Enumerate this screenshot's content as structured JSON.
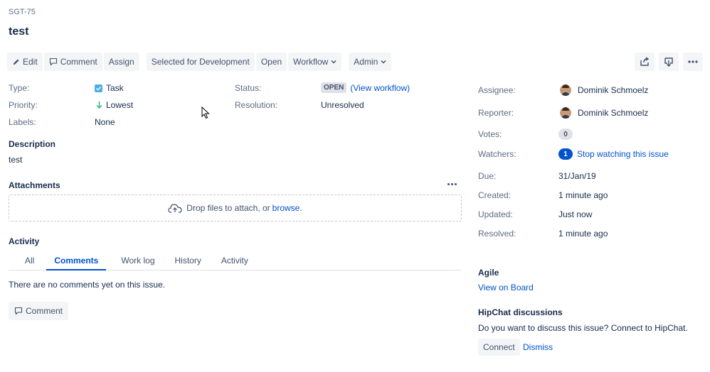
{
  "issue": {
    "key": "SGT-75",
    "title": "test"
  },
  "toolbar": {
    "edit": "Edit",
    "comment": "Comment",
    "assign": "Assign",
    "selected_for_dev": "Selected for Development",
    "open": "Open",
    "workflow": "Workflow",
    "admin": "Admin"
  },
  "details": {
    "type_label": "Type:",
    "type_value": "Task",
    "priority_label": "Priority:",
    "priority_value": "Lowest",
    "labels_label": "Labels:",
    "labels_value": "None",
    "status_label": "Status:",
    "status_value": "OPEN",
    "view_workflow": "(View workflow)",
    "resolution_label": "Resolution:",
    "resolution_value": "Unresolved"
  },
  "description": {
    "title": "Description",
    "text": "test"
  },
  "attachments": {
    "title": "Attachments",
    "drop_text": "Drop files to attach, or",
    "browse": "browse."
  },
  "activity": {
    "title": "Activity",
    "tabs": [
      "All",
      "Comments",
      "Work log",
      "History",
      "Activity"
    ],
    "active_tab": "Comments",
    "empty_text": "There are no comments yet on this issue.",
    "comment_button": "Comment"
  },
  "people": {
    "assignee_label": "Assignee:",
    "assignee": "Dominik Schmoelz",
    "reporter_label": "Reporter:",
    "reporter": "Dominik Schmoelz",
    "votes_label": "Votes:",
    "votes": "0",
    "watchers_label": "Watchers:",
    "watchers": "1",
    "stop_watching": "Stop watching this issue"
  },
  "dates": {
    "due_label": "Due:",
    "due": "31/Jan/19",
    "created_label": "Created:",
    "created": "1 minute ago",
    "updated_label": "Updated:",
    "updated": "Just now",
    "resolved_label": "Resolved:",
    "resolved": "1 minute ago"
  },
  "agile": {
    "title": "Agile",
    "link": "View on Board"
  },
  "hipchat": {
    "title": "HipChat discussions",
    "text": "Do you want to discuss this issue? Connect to HipChat.",
    "connect": "Connect",
    "dismiss": "Dismiss"
  },
  "colors": {
    "link": "#0052cc",
    "text": "#172b4d",
    "muted": "#5e6c84",
    "button_bg": "#f4f5f7",
    "priority_lowest": "#36b37e",
    "task_blue": "#4bade8"
  },
  "icons": [
    "pencil-icon",
    "comment-icon",
    "chevron-down-icon",
    "share-icon",
    "export-icon",
    "more-icon",
    "task-icon",
    "arrow-down-icon",
    "cloud-upload-icon",
    "avatar",
    "mouse-cursor-icon"
  ]
}
